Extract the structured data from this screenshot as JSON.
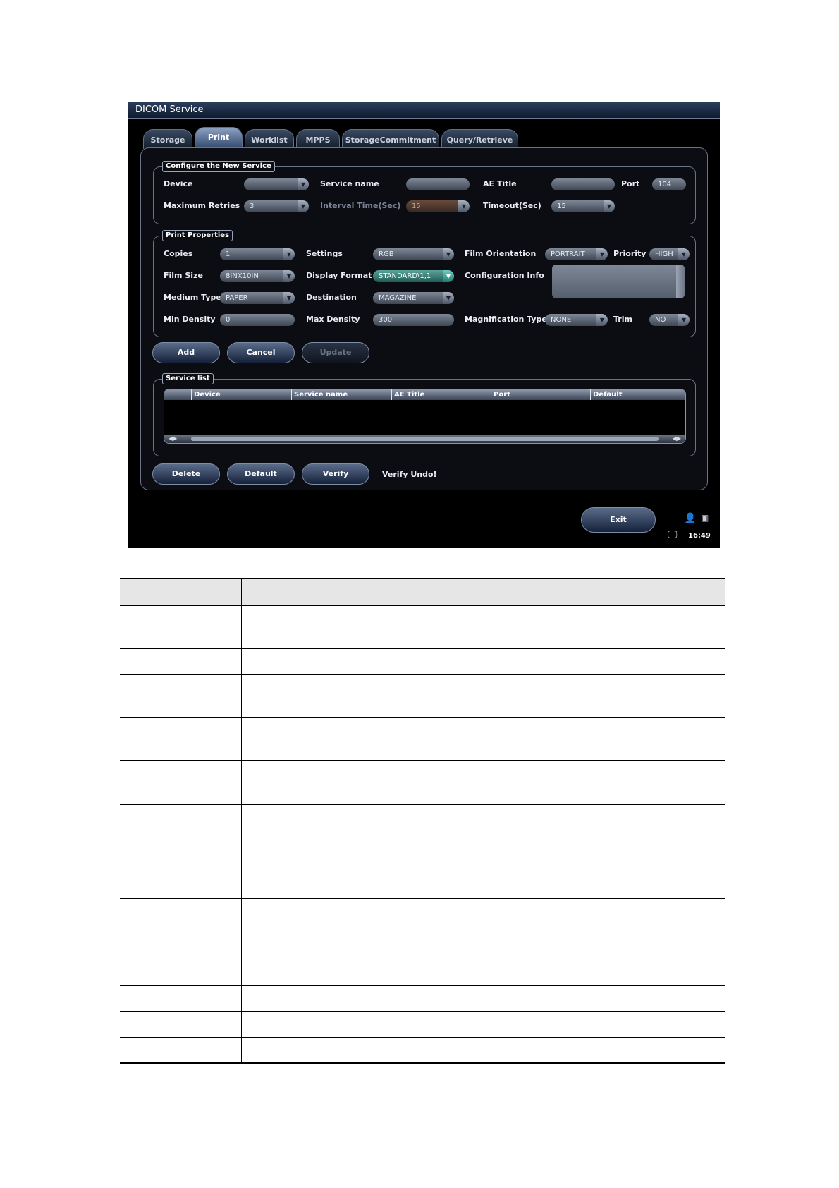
{
  "window": {
    "title": "DICOM Service"
  },
  "tabs": [
    {
      "label": "Storage"
    },
    {
      "label": "Print"
    },
    {
      "label": "Worklist"
    },
    {
      "label": "MPPS"
    },
    {
      "label": "StorageCommitment"
    },
    {
      "label": "Query/Retrieve"
    }
  ],
  "configure": {
    "legend": "Configure the New Service",
    "device_label": "Device",
    "device_value": "",
    "service_name_label": "Service name",
    "service_name_value": "",
    "ae_title_label": "AE Title",
    "ae_title_value": "",
    "port_label": "Port",
    "port_value": "104",
    "max_retries_label": "Maximum Retries",
    "max_retries_value": "3",
    "interval_label": "Interval Time(Sec)",
    "interval_value": "15",
    "timeout_label": "Timeout(Sec)",
    "timeout_value": "15"
  },
  "print_props": {
    "legend": "Print Properties",
    "copies_label": "Copies",
    "copies_value": "1",
    "settings_label": "Settings",
    "settings_value": "RGB",
    "film_orientation_label": "Film Orientation",
    "film_orientation_value": "PORTRAIT",
    "priority_label": "Priority",
    "priority_value": "HIGH",
    "film_size_label": "Film Size",
    "film_size_value": "8INX10IN",
    "display_format_label": "Display Format",
    "display_format_value": "STANDARD\\1,1",
    "config_info_label": "Configuration Info",
    "medium_type_label": "Medium Type",
    "medium_type_value": "PAPER",
    "destination_label": "Destination",
    "destination_value": "MAGAZINE",
    "min_density_label": "Min Density",
    "min_density_value": "0",
    "max_density_label": "Max Density",
    "max_density_value": "300",
    "magnification_label": "Magnification Type",
    "magnification_value": "NONE",
    "trim_label": "Trim",
    "trim_value": "NO"
  },
  "actions": {
    "add": "Add",
    "cancel": "Cancel",
    "update": "Update"
  },
  "service_list": {
    "legend": "Service list",
    "columns": [
      "Device",
      "Service name",
      "AE Title",
      "Port",
      "Default"
    ]
  },
  "bottom": {
    "delete": "Delete",
    "default": "Default",
    "verify": "Verify",
    "verify_status": "Verify Undo!"
  },
  "exit": "Exit",
  "clock": "16:49"
}
